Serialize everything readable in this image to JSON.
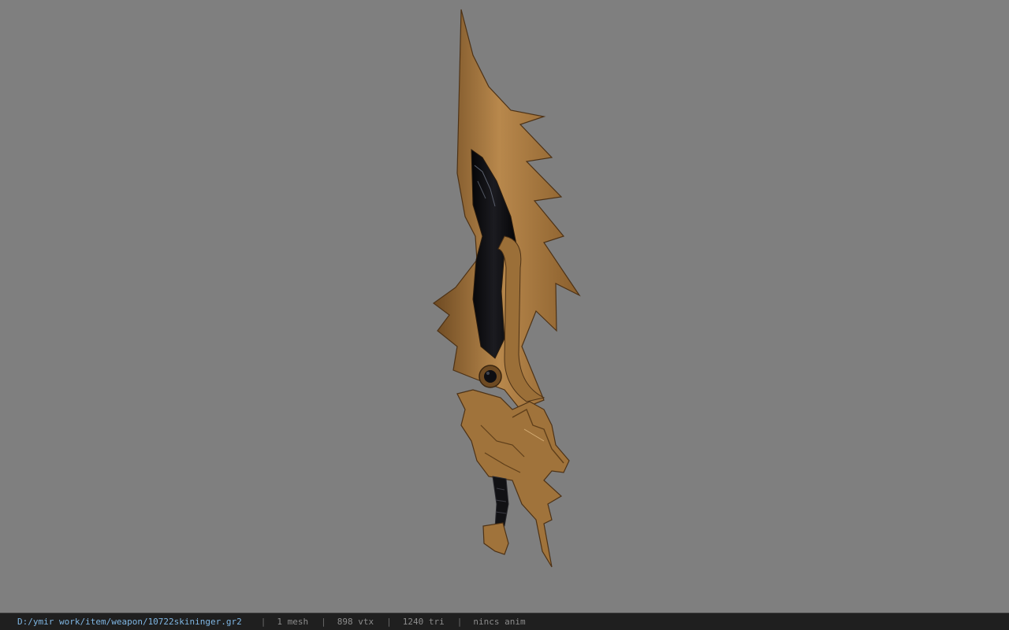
{
  "status_bar": {
    "path": "D:/ymir work/item/weapon/10722skininger.gr2",
    "separator": "|",
    "mesh": "1 mesh",
    "vertices": "898 vtx",
    "triangles": "1240 tri",
    "animation": "nincs anim"
  },
  "viewport": {
    "background_color": "#808080",
    "model_colors": {
      "gold": "#a7793f",
      "gold_light": "#c9a06a",
      "gold_dark": "#6e4a22",
      "black_core": "#0d0d10"
    }
  }
}
